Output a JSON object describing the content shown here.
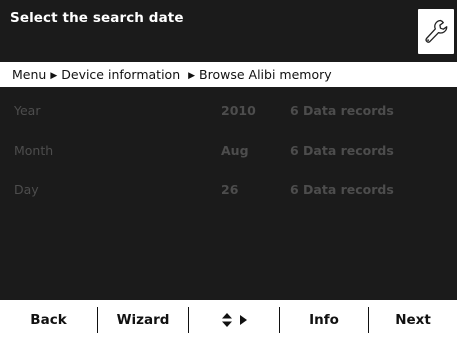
{
  "header": {
    "title": "Select the search date",
    "settings_icon": "wrench-icon"
  },
  "breadcrumb": {
    "items": [
      "Menu",
      "Device information",
      "Browse Alibi memory"
    ]
  },
  "rows": [
    {
      "label": "Year",
      "value": "2010",
      "records": "6 Data records"
    },
    {
      "label": "Month",
      "value": "Aug",
      "records": "6 Data records"
    },
    {
      "label": "Day",
      "value": "26",
      "records": "6 Data records"
    }
  ],
  "footer": {
    "back": "Back",
    "wizard": "Wizard",
    "nav_icons": [
      "up-down-arrow-icon",
      "right-arrow-icon"
    ],
    "info": "Info",
    "next": "Next"
  },
  "colors": {
    "background_dark": "#1b1b1b",
    "dimmed_text": "#4d4d4d"
  }
}
